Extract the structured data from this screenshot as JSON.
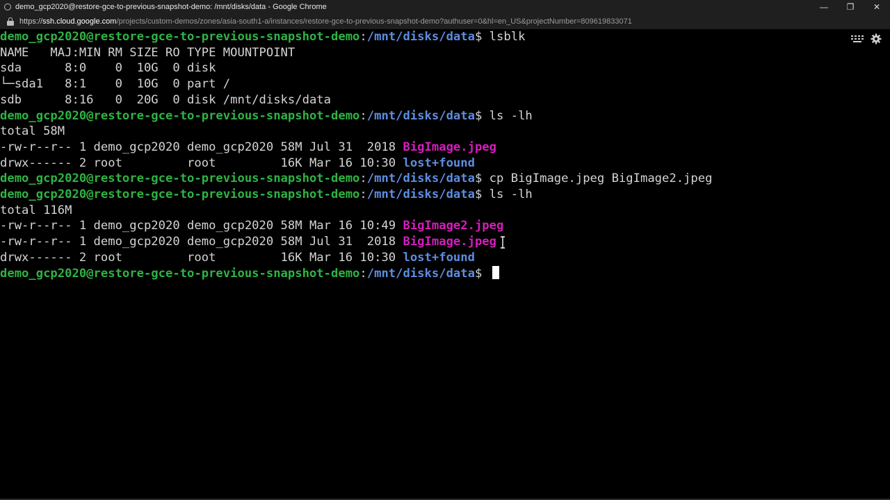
{
  "window": {
    "title": "demo_gcp2020@restore-gce-to-previous-snapshot-demo: /mnt/disks/data - Google Chrome",
    "controls": {
      "minimize": "—",
      "restore": "❐",
      "close": "✕"
    }
  },
  "urlbar": {
    "scheme": "https://",
    "host": "ssh.cloud.google.com",
    "path": "/projects/custom-demos/zones/asia-south1-a/instances/restore-gce-to-previous-snapshot-demo?authuser=0&hl=en_US&projectNumber=809619833071"
  },
  "terminal": {
    "prompt_user": "demo_gcp2020@restore-gce-to-previous-snapshot-demo",
    "prompt_sep": ":",
    "prompt_path": "/mnt/disks/data",
    "prompt_end": "$ ",
    "commands": {
      "c1": "lsblk",
      "c2": "ls -lh",
      "c3": "cp BigImage.jpeg BigImage2.jpeg",
      "c4": "ls -lh"
    },
    "lsblk": {
      "header": "NAME   MAJ:MIN RM SIZE RO TYPE MOUNTPOINT",
      "rows": [
        "sda      8:0    0  10G  0 disk",
        "└─sda1   8:1    0  10G  0 part /",
        "sdb      8:16   0  20G  0 disk /mnt/disks/data"
      ]
    },
    "ls1": {
      "total": "total 58M",
      "rows": [
        {
          "meta": "-rw-r--r-- 1 demo_gcp2020 demo_gcp2020 58M Jul 31  2018 ",
          "name": "BigImage.jpeg"
        },
        {
          "meta": "drwx------ 2 root         root         16K Mar 16 10:30 ",
          "name": "lost+found"
        }
      ]
    },
    "ls2": {
      "total": "total 116M",
      "rows": [
        {
          "meta": "-rw-r--r-- 1 demo_gcp2020 demo_gcp2020 58M Mar 16 10:49 ",
          "name": "BigImage2.jpeg"
        },
        {
          "meta": "-rw-r--r-- 1 demo_gcp2020 demo_gcp2020 58M Jul 31  2018 ",
          "name": "BigImage.jpeg"
        },
        {
          "meta": "drwx------ 2 root         root         16K Mar 16 10:30 ",
          "name": "lost+found"
        }
      ]
    }
  },
  "icons": {
    "keyboard": "keyboard-icon",
    "settings": "gear-icon"
  }
}
